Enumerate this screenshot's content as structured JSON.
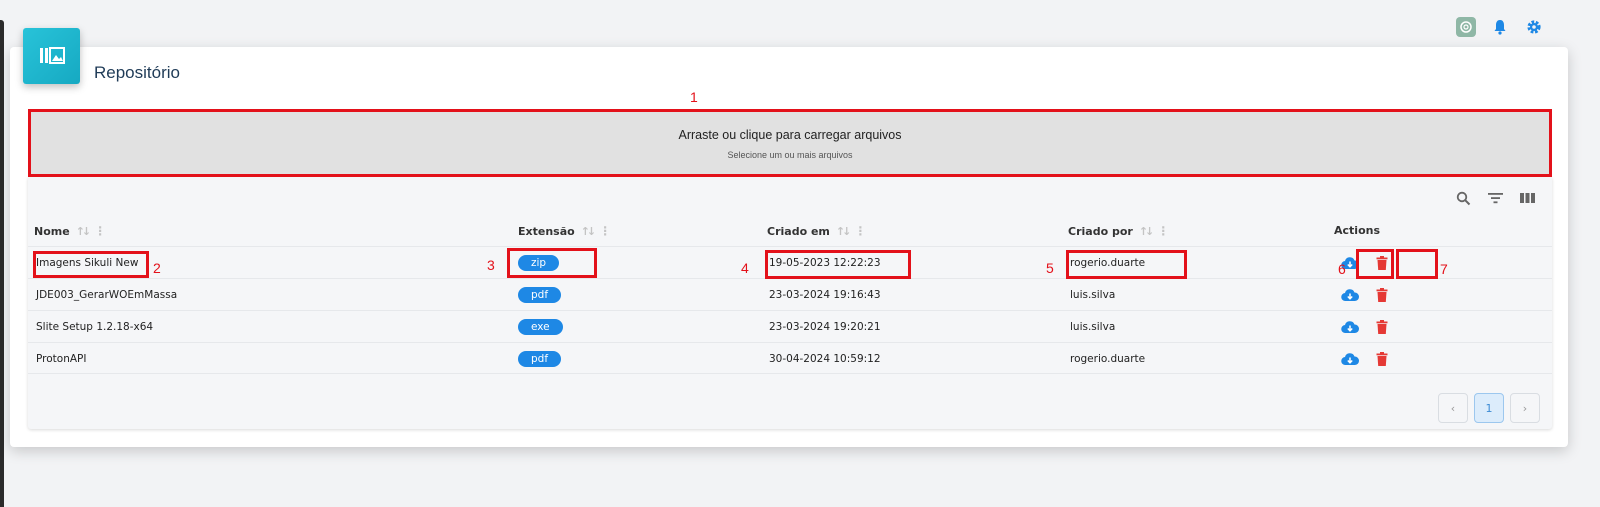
{
  "colors": {
    "accent": "#1e88e5",
    "danger": "#e53935",
    "annotation": "#e3111a",
    "header_gradient": "#1fb6cf"
  },
  "topbar": {
    "icons": [
      "chatgpt-icon",
      "bell-icon",
      "gear-icon"
    ]
  },
  "page": {
    "title": "Repositório"
  },
  "dropzone": {
    "main": "Arraste ou clique para carregar arquivos",
    "sub": "Selecione um ou mais arquivos"
  },
  "table": {
    "columns": {
      "name": "Nome",
      "ext": "Extensão",
      "created_at": "Criado em",
      "created_by": "Criado por",
      "actions": "Actions"
    },
    "rows": [
      {
        "name": "Imagens Sikuli New",
        "ext": "zip",
        "created_at": "19-05-2023 12:22:23",
        "created_by": "rogerio.duarte"
      },
      {
        "name": "JDE003_GerarWOEmMassa",
        "ext": "pdf",
        "created_at": "23-03-2024 19:16:43",
        "created_by": "luis.silva"
      },
      {
        "name": "Slite Setup 1.2.18-x64",
        "ext": "exe",
        "created_at": "23-03-2024 19:20:21",
        "created_by": "luis.silva"
      },
      {
        "name": "ProtonAPI",
        "ext": "pdf",
        "created_at": "30-04-2024 10:59:12",
        "created_by": "rogerio.duarte"
      }
    ]
  },
  "pagination": {
    "prev": "‹",
    "current": "1",
    "next": "›"
  },
  "annotations": [
    "1",
    "2",
    "3",
    "4",
    "5",
    "6",
    "7"
  ]
}
